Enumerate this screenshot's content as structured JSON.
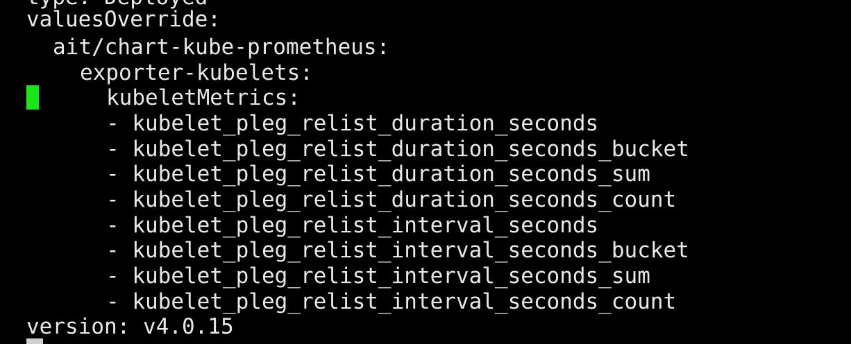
{
  "terminal": {
    "cursor_color": "#19e619",
    "text_color": "#e8e8e8",
    "background_color": "#000000",
    "top_partial": "type: Deployed",
    "lines": [
      "valuesOverride:",
      "ait/chart-kube-prometheus:",
      "exporter-kubelets:",
      "kubeletMetrics:",
      "- kubelet_pleg_relist_duration_seconds",
      "- kubelet_pleg_relist_duration_seconds_bucket",
      "- kubelet_pleg_relist_duration_seconds_sum",
      "- kubelet_pleg_relist_duration_seconds_count",
      "- kubelet_pleg_relist_interval_seconds",
      "- kubelet_pleg_relist_interval_seconds_bucket",
      "- kubelet_pleg_relist_interval_seconds_sum",
      "- kubelet_pleg_relist_interval_seconds_count",
      "version: v4.0.15"
    ]
  }
}
